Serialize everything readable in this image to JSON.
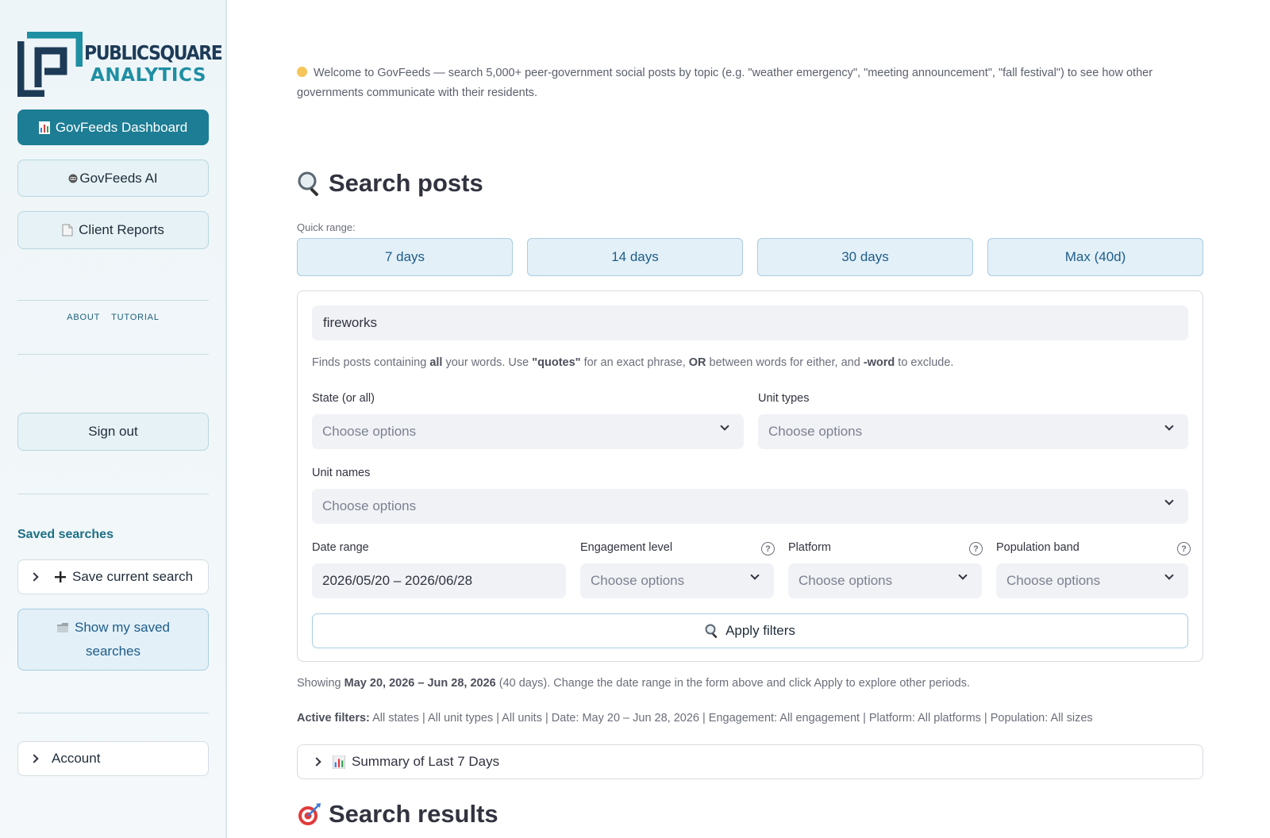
{
  "brand": {
    "line1": "PUBLICSQUARE",
    "line2": "ANALYTICS"
  },
  "sidebar": {
    "dashboard_label": "GovFeeds Dashboard",
    "ai_label": "GovFeeds AI",
    "reports_label": "Client Reports",
    "about_label": "ABOUT",
    "tutorial_label": "TUTORIAL",
    "signout_label": "Sign out",
    "saved_title": "Saved searches",
    "save_current_label": "Save current search",
    "show_saved_line1": "Show my saved",
    "show_saved_line2": "searches",
    "account_label": "Account"
  },
  "main": {
    "welcome": "Welcome to GovFeeds — search 5,000+ peer-government social posts by topic (e.g. \"weather emergency\", \"meeting announcement\", \"fall festival\") to see how other governments communicate with their residents.",
    "search_heading": "Search posts",
    "quick_range_label": "Quick range:",
    "quick_ranges": [
      "7 days",
      "14 days",
      "30 days",
      "Max (40d)"
    ],
    "search_value": "fireworks",
    "hint": {
      "p1": "Finds posts containing ",
      "b1": "all",
      "p2": " your words. Use ",
      "b2": "\"quotes\"",
      "p3": " for an exact phrase, ",
      "b3": "OR",
      "p4": " between words for either, and ",
      "b4": "-word",
      "p5": " to exclude."
    },
    "state_label": "State (or all)",
    "unit_types_label": "Unit types",
    "unit_names_label": "Unit names",
    "date_range_label": "Date range",
    "engagement_label": "Engagement level",
    "platform_label": "Platform",
    "population_label": "Population band",
    "choose_placeholder": "Choose options",
    "date_value": "2026/05/20 – 2026/06/28",
    "help_glyph": "?",
    "apply_label": "Apply filters",
    "showing": {
      "p1": "Showing ",
      "b1": "May 20, 2026 – Jun 28, 2026",
      "p2": " (40 days). Change the date range in the form above and click Apply to explore other periods."
    },
    "active": {
      "label": "Active filters:",
      "text": " All states | All unit types | All units | Date: May 20 – Jun 28, 2026 | Engagement: All engagement | Platform: All platforms | Population: All sizes"
    },
    "summary_label": "Summary of Last 7 Days",
    "results_heading": "Search results"
  },
  "colors": {
    "primary": "#1c7d94",
    "accent_blue": "#1e5d89",
    "sidebar_bg": "#eef5f8"
  },
  "icons": [
    "logo-mark",
    "bar-chart-icon",
    "robot-icon",
    "document-icon",
    "folder-icon",
    "plus-icon",
    "magnifier-icon",
    "target-icon",
    "chevron-right-icon",
    "chevron-down-icon",
    "help-icon",
    "smile-icon"
  ]
}
